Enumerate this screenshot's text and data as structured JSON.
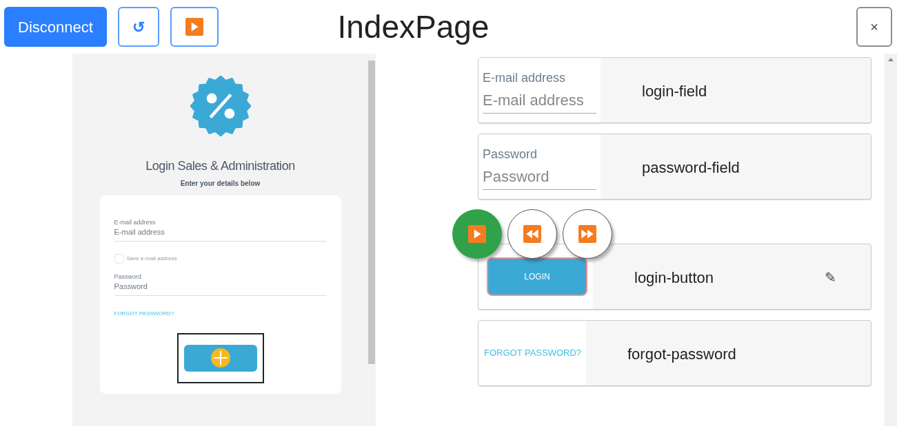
{
  "toolbar": [
    {
      "kind": "text",
      "label": "Disconnect"
    },
    {
      "kind": "glyph",
      "label": "↺"
    },
    {
      "kind": "play"
    }
  ],
  "title": "IndexPage",
  "close": "×",
  "preview": {
    "heading": "Login Sales & Administration",
    "subheading": "Enter your details below",
    "email_label": "E-mail address",
    "email_placeholder": "E-mail address",
    "checkbox": {
      "label": "Save e-mail address",
      "checked": false
    },
    "password_label": "Password",
    "password_placeholder": "Password",
    "forgot": "FORGOT PASSWORD?"
  },
  "elements": [
    {
      "kind": "field",
      "label": "E-mail address",
      "placeholder": "E-mail address",
      "name": "login-field"
    },
    {
      "kind": "field",
      "label": "Password",
      "placeholder": "Password",
      "name": "password-field"
    },
    {
      "kind": "button",
      "text": "LOGIN",
      "name": "login-button",
      "edit": "✎"
    },
    {
      "kind": "link",
      "text": "FORGOT PASSWORD?",
      "name": "forgot-password"
    }
  ],
  "playback": [
    {
      "kind": "play",
      "active": true
    },
    {
      "kind": "rewind",
      "active": false
    },
    {
      "kind": "forward",
      "active": false
    }
  ]
}
